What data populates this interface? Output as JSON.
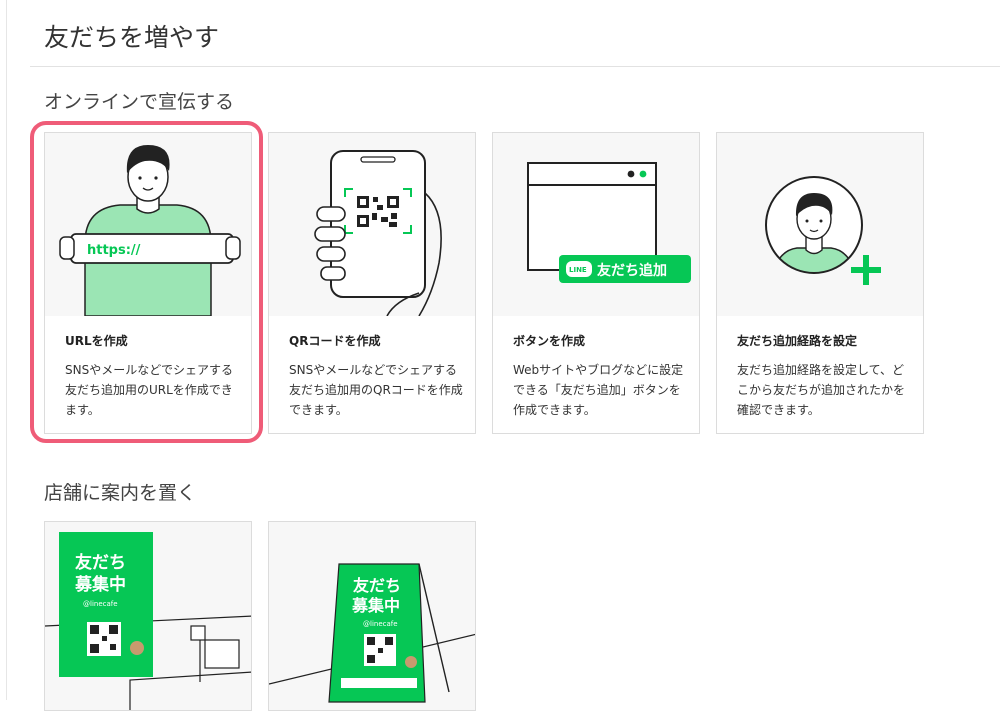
{
  "page": {
    "title": "友だちを増やす"
  },
  "sections": {
    "online": {
      "title": "オンラインで宣伝する"
    },
    "store": {
      "title": "店舗に案内を置く"
    }
  },
  "cards": [
    {
      "title": "URLを作成",
      "description": "SNSやメールなどでシェアする友だち追加用のURLを作成できます。",
      "illustration_text": "https://"
    },
    {
      "title": "QRコードを作成",
      "description": "SNSやメールなどでシェアする友だち追加用のQRコードを作成できます。"
    },
    {
      "title": "ボタンを作成",
      "description": "Webサイトやブログなどに設定できる「友だち追加」ボタンを作成できます。",
      "badge_logo": "LINE",
      "badge_label": "友だち追加"
    },
    {
      "title": "友だち追加経路を設定",
      "description": "友だち追加経路を設定して、どこから友だちが追加されたかを確認できます。"
    }
  ],
  "posters": [
    {
      "line1": "友だち",
      "line2": "募集中",
      "handle": "@linecafe"
    },
    {
      "line1": "友だち",
      "line2": "募集中",
      "handle": "@linecafe"
    }
  ],
  "colors": {
    "line_green": "#06c755",
    "illustration_green": "#9be5b4",
    "highlight": "#ef5c78"
  }
}
